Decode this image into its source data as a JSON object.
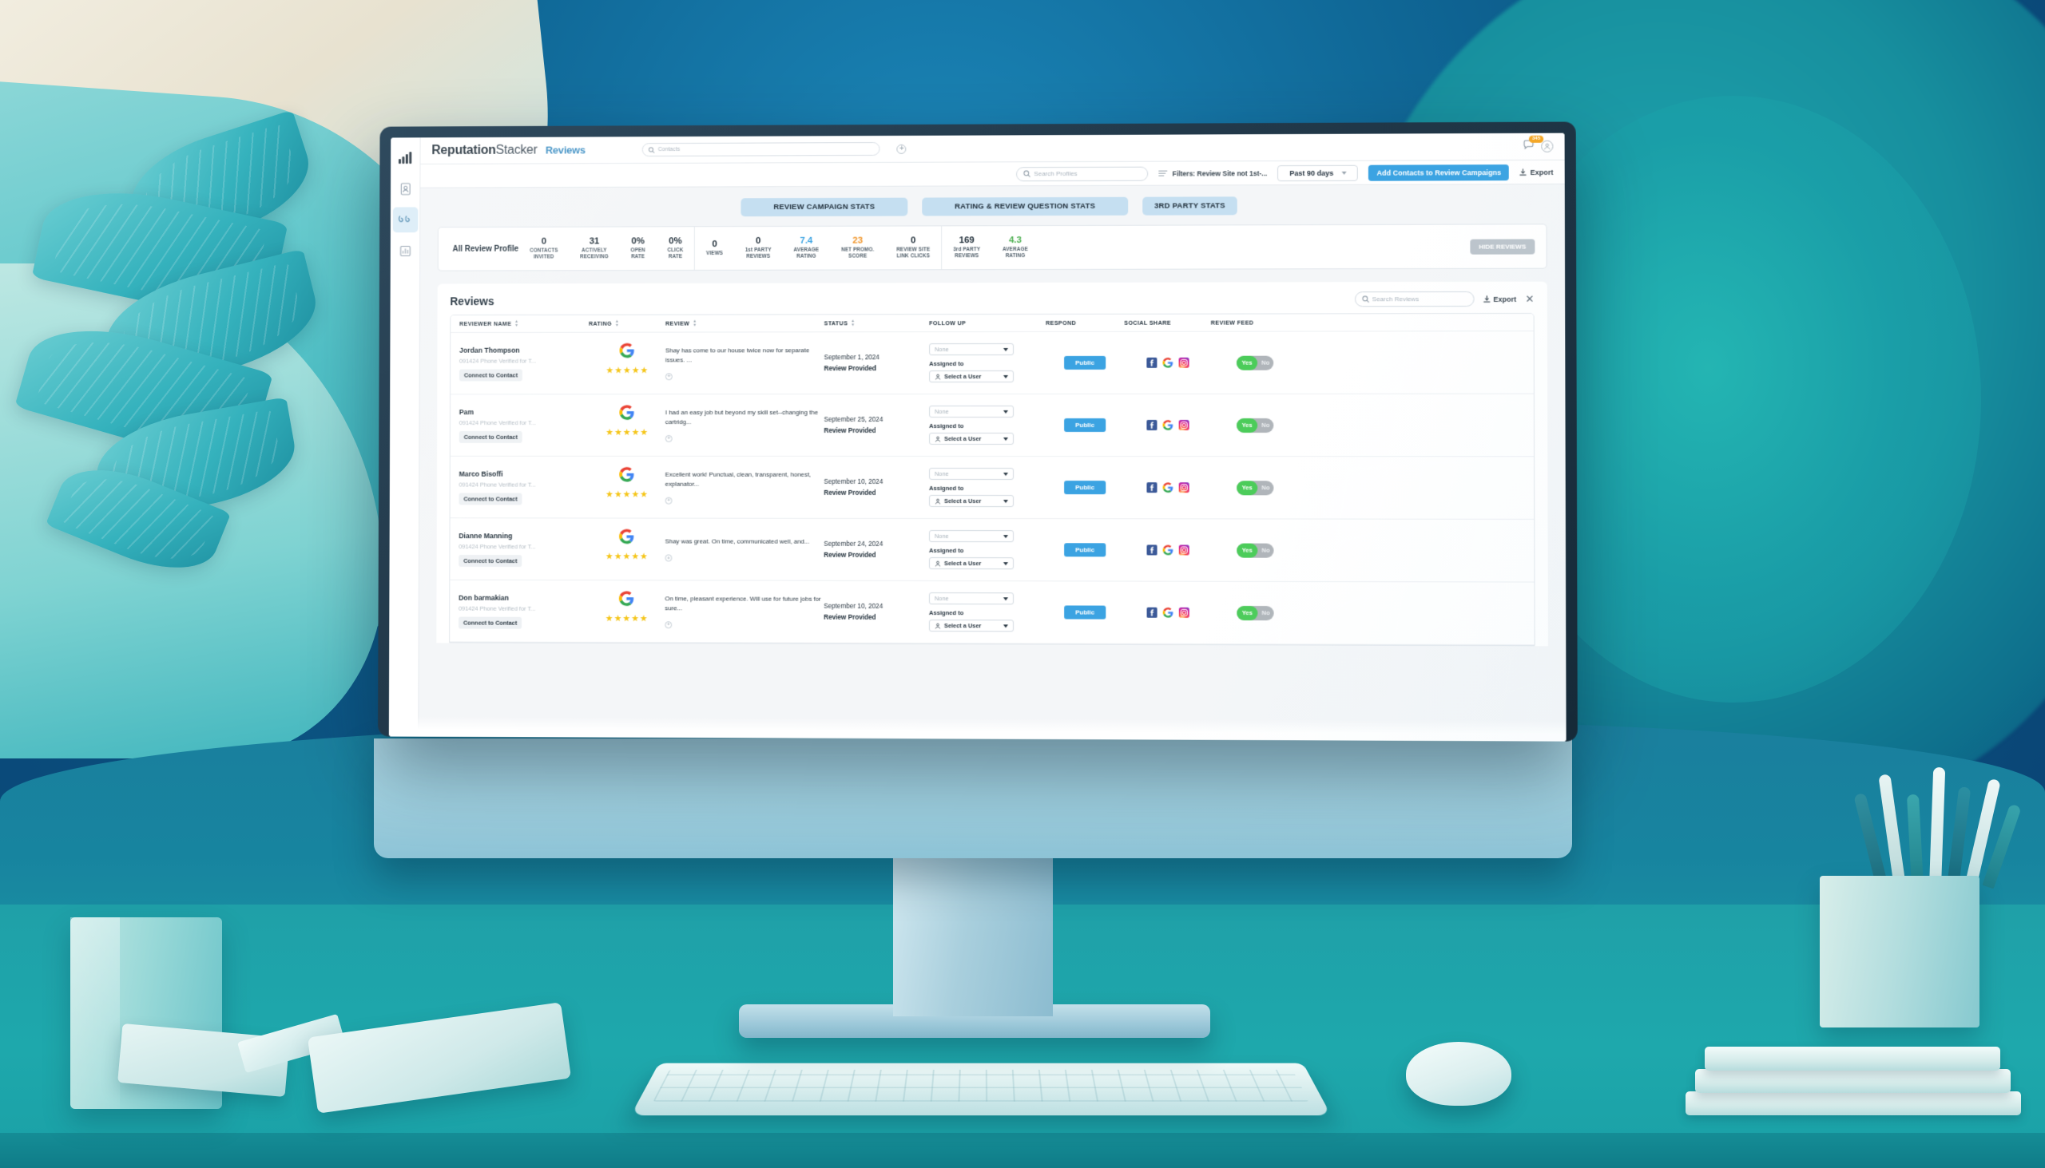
{
  "app": {
    "brand_bold": "Reputation",
    "brand_light": "Stacker",
    "section": "Reviews"
  },
  "rail": {
    "items": [
      {
        "name": "analytics-logo-icon",
        "label": "Analytics"
      },
      {
        "name": "contacts-icon",
        "label": "Contacts"
      },
      {
        "name": "reviews-quote-icon",
        "label": "Reviews"
      },
      {
        "name": "reports-chart-icon",
        "label": "Reports"
      }
    ]
  },
  "topbar": {
    "search_placeholder": "Contacts",
    "add_icon": "plus-circle-icon",
    "notification_count": "345",
    "avatar_icon": "user-avatar-icon"
  },
  "subbar": {
    "profile_search_placeholder": "Search Profiles",
    "filters_label": "Filters: Review Site not 1st-...",
    "date_range": "Past 90 days",
    "add_contacts_button": "Add Contacts to Review Campaigns",
    "export_label": "Export"
  },
  "tabs": [
    {
      "label": "REVIEW CAMPAIGN STATS",
      "width": "w1"
    },
    {
      "label": "RATING & REVIEW QUESTION STATS",
      "width": "w2"
    },
    {
      "label": "3RD PARTY STATS",
      "width": "w3"
    }
  ],
  "stats": {
    "profile_label": "All Review Profile",
    "hide_button": "HIDE REVIEWS",
    "group1": [
      {
        "value": "0",
        "label": "CONTACTS\nINVITED",
        "color": ""
      },
      {
        "value": "31",
        "label": "ACTIVELY\nRECEIVING",
        "color": ""
      },
      {
        "value": "0%",
        "label": "OPEN\nRATE",
        "color": ""
      },
      {
        "value": "0%",
        "label": "CLICK\nRATE",
        "color": ""
      }
    ],
    "group2": [
      {
        "value": "0",
        "label": "VIEWS",
        "color": ""
      },
      {
        "value": "0",
        "label": "1st PARTY\nREVIEWS",
        "color": ""
      },
      {
        "value": "7.4",
        "label": "AVERAGE\nRATING",
        "color": "blue"
      },
      {
        "value": "23",
        "label": "NET PROMO.\nSCORE",
        "color": "orange"
      },
      {
        "value": "0",
        "label": "REVIEW SITE\nLINK CLICKS",
        "color": ""
      }
    ],
    "group3": [
      {
        "value": "169",
        "label": "3rd PARTY\nREVIEWS",
        "color": ""
      },
      {
        "value": "4.3",
        "label": "AVERAGE\nRATING",
        "color": "green"
      }
    ]
  },
  "reviews": {
    "title": "Reviews",
    "search_placeholder": "Search Reviews",
    "export_label": "Export",
    "close_icon": "close-icon",
    "columns": [
      {
        "label": "REVIEWER NAME",
        "sortable": true
      },
      {
        "label": "RATING",
        "sortable": true
      },
      {
        "label": "REVIEW",
        "sortable": true
      },
      {
        "label": "STATUS",
        "sortable": true
      },
      {
        "label": "FOLLOW UP",
        "sortable": false
      },
      {
        "label": "RESPOND",
        "sortable": false
      },
      {
        "label": "SOCIAL SHARE",
        "sortable": false
      },
      {
        "label": "REVIEW FEED",
        "sortable": false
      }
    ],
    "followup_none": "None",
    "assigned_label": "Assigned to",
    "select_user": "Select a User",
    "respond_button": "Public",
    "connect_button": "Connect to Contact",
    "toggle_yes": "Yes",
    "toggle_no": "No",
    "rows": [
      {
        "name": "Jordan Thompson",
        "meta": "091424 Phone Verified for T...",
        "source": "google-icon",
        "stars": 5,
        "review": "Shay has come to our house twice now for separate issues. ...",
        "date": "September 1, 2024",
        "status": "Review Provided",
        "feed": "yes"
      },
      {
        "name": "Pam",
        "meta": "091424 Phone Verified for T...",
        "source": "google-icon",
        "stars": 5,
        "review": "I had an easy job but beyond my skill set--changing the cartridg...",
        "date": "September 25, 2024",
        "status": "Review Provided",
        "feed": "yes"
      },
      {
        "name": "Marco Bisoffi",
        "meta": "091424 Phone Verified for T...",
        "source": "google-icon",
        "stars": 5,
        "review": "Excellent work! Punctual, clean, transparent, honest, explanator...",
        "date": "September 10, 2024",
        "status": "Review Provided",
        "feed": "yes"
      },
      {
        "name": "Dianne Manning",
        "meta": "091424 Phone Verified for T...",
        "source": "google-icon",
        "stars": 5,
        "review": "Shay was great. On time, communicated well, and...",
        "date": "September 24, 2024",
        "status": "Review Provided",
        "feed": "yes"
      },
      {
        "name": "Don barmakian",
        "meta": "091424 Phone Verified for T...",
        "source": "google-icon",
        "stars": 5,
        "review": "On time, pleasant experience. Will use for future jobs for sure...",
        "date": "September 10, 2024",
        "status": "Review Provided",
        "feed": "yes"
      }
    ]
  },
  "colors": {
    "accent_blue": "#3ba3e2",
    "tab_blue": "#c5dff1",
    "star_yellow": "#f5c518",
    "toggle_green": "#4ccc5a",
    "badge_orange": "#f5a623",
    "nps_orange": "#f0952a",
    "avg_green": "#4caf50"
  }
}
